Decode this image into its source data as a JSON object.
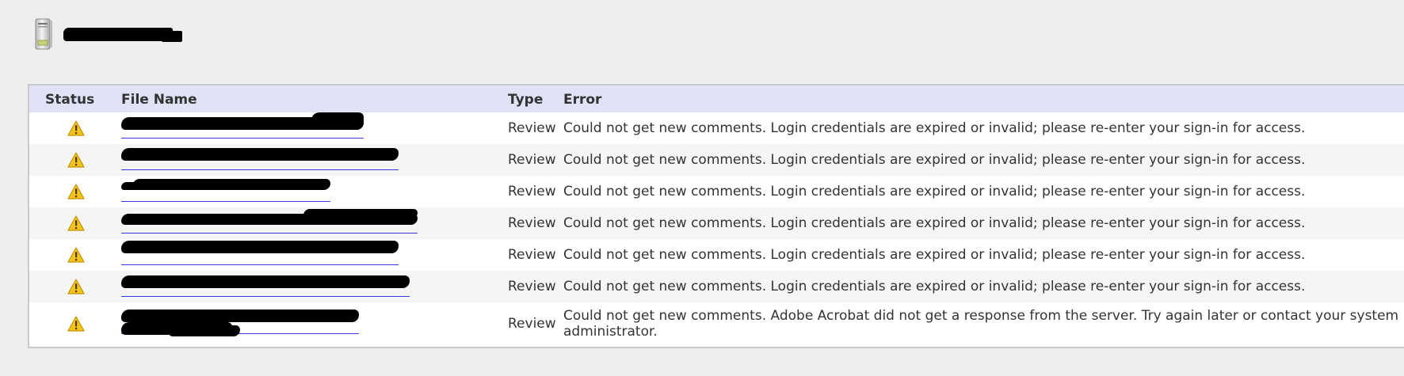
{
  "header": {
    "icon": "server-icon",
    "title": ""
  },
  "table": {
    "columns": [
      "Status",
      "File Name",
      "Type",
      "Error"
    ],
    "rows": [
      {
        "status": "warning-icon",
        "file_name": "",
        "type": "Review",
        "error": "Could not get new comments. Login credentials are expired or invalid; please re-enter your sign-in for access."
      },
      {
        "status": "warning-icon",
        "file_name": "",
        "type": "Review",
        "error": "Could not get new comments. Login credentials are expired or invalid; please re-enter your sign-in for access."
      },
      {
        "status": "warning-icon",
        "file_name": "",
        "type": "Review",
        "error": "Could not get new comments. Login credentials are expired or invalid; please re-enter your sign-in for access."
      },
      {
        "status": "warning-icon",
        "file_name": "",
        "type": "Review",
        "error": "Could not get new comments. Login credentials are expired or invalid; please re-enter your sign-in for access."
      },
      {
        "status": "warning-icon",
        "file_name": "",
        "type": "Review",
        "error": "Could not get new comments. Login credentials are expired or invalid; please re-enter your sign-in for access."
      },
      {
        "status": "warning-icon",
        "file_name": "",
        "type": "Review",
        "error": "Could not get new comments. Login credentials are expired or invalid; please re-enter your sign-in for access."
      },
      {
        "status": "warning-icon",
        "file_name": "",
        "type": "Review",
        "error": "Could not get new comments. Adobe Acrobat did not get a response from the server. Try again later or contact your system administrator."
      }
    ]
  },
  "colors": {
    "page_background": "#eeeeee",
    "header_row": "#e1e1f7",
    "alt_row": "#f5f5f5",
    "link": "#3b3bd6",
    "warning_fill": "#f5c518"
  }
}
